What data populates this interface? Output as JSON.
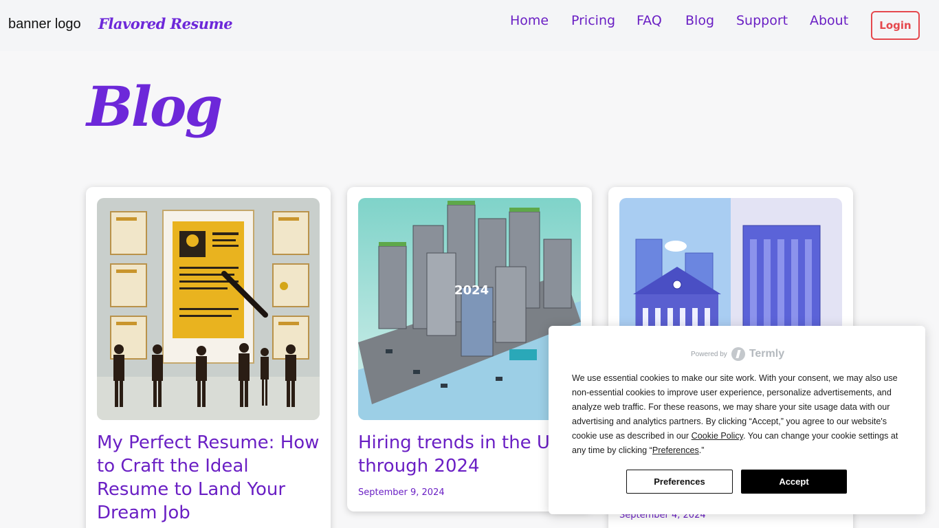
{
  "header": {
    "logo_alt": "banner logo",
    "brand": "Flavored Resume",
    "nav": [
      {
        "label": "Home"
      },
      {
        "label": "Pricing"
      },
      {
        "label": "FAQ"
      },
      {
        "label": "Blog"
      },
      {
        "label": "Support"
      },
      {
        "label": "About"
      }
    ],
    "login_label": "Login"
  },
  "page": {
    "title": "Blog"
  },
  "posts": [
    {
      "title": "My Perfect Resume: How to Craft the Ideal Resume to Land Your Dream Job",
      "date": "",
      "image_icon": "resume-illustration"
    },
    {
      "title": "Hiring trends in the US through 2024",
      "date": "September 9, 2024",
      "image_icon": "city-2024-illustration"
    },
    {
      "title": "",
      "date": "September 4, 2024",
      "image_icon": "buildings-illustration"
    }
  ],
  "cookie_banner": {
    "powered_by": "Powered by",
    "provider": "Termly",
    "text_1": "We use essential cookies to make our site work. With your consent, we may also use non-essential cookies to improve user experience, personalize advertisements, and analyze web traffic. For these reasons, we may share your site usage data with our advertising and analytics partners. By clicking “Accept,” you agree to our website's cookie use as described in our ",
    "cookie_policy_link": "Cookie Policy",
    "text_2": ". You can change your cookie settings at any time by clicking “",
    "preferences_link": "Preferences",
    "text_3": ".”",
    "preferences_button": "Preferences",
    "accept_button": "Accept"
  },
  "colors": {
    "brand_purple": "#6d28d9",
    "link_purple": "#6a1fc4",
    "login_red": "#e5484d"
  }
}
